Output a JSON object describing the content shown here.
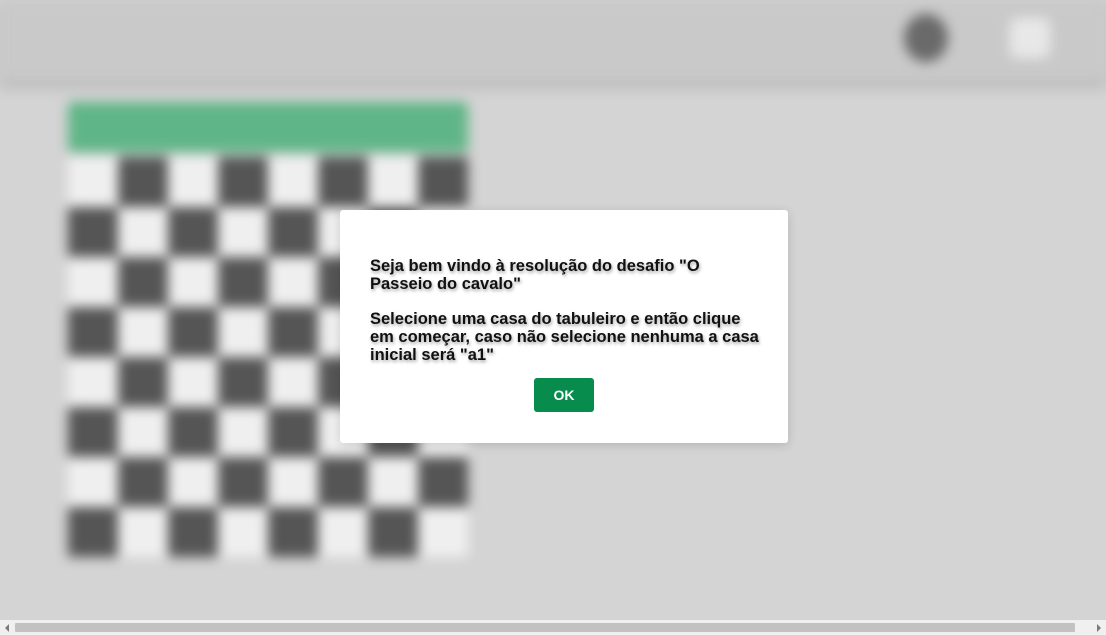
{
  "modal": {
    "welcome": "Seja bem vindo à resolução do desafio \"O Passeio do cavalo\"",
    "instructions": "Selecione uma casa do tabuleiro e então clique em começar, caso não selecione nenhuma a casa inicial será \"a1\"",
    "ok_label": "OK",
    "ok_color": "#078c4d"
  },
  "colors": {
    "background": "#d4d4d4",
    "square_light": "#efefef",
    "square_dark": "#555555",
    "start_button": "#5fb587"
  },
  "icons": {
    "header_left": "knight-icon",
    "header_right": "menu-icon",
    "scroll_left": "arrow-left-icon",
    "scroll_right": "arrow-right-icon"
  },
  "board": {
    "size": 8
  }
}
